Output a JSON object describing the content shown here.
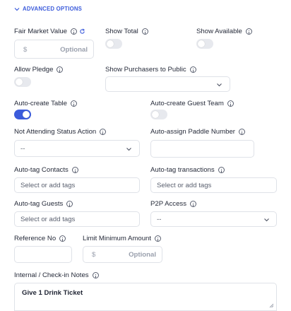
{
  "section": {
    "title": "ADVANCED OPTIONS",
    "color": "#3b5bdb"
  },
  "fields": {
    "fair_market_value": {
      "label": "Fair Market Value",
      "prefix": "$",
      "placeholder": "Optional"
    },
    "show_total": {
      "label": "Show Total",
      "enabled": false
    },
    "show_available": {
      "label": "Show Available",
      "enabled": false
    },
    "allow_pledge": {
      "label": "Allow Pledge",
      "enabled": false
    },
    "show_purchasers": {
      "label": "Show Purchasers to Public",
      "value": ""
    },
    "auto_create_table": {
      "label": "Auto-create Table",
      "enabled": true
    },
    "auto_create_guest_team": {
      "label": "Auto-create Guest Team",
      "enabled": false
    },
    "not_attending_status": {
      "label": "Not Attending Status Action",
      "value": "--"
    },
    "auto_assign_paddle": {
      "label": "Auto-assign Paddle Number",
      "value": ""
    },
    "auto_tag_contacts": {
      "label": "Auto-tag Contacts",
      "placeholder": "Select or add tags"
    },
    "auto_tag_transactions": {
      "label": "Auto-tag transactions",
      "placeholder": "Select or add tags"
    },
    "auto_tag_guests": {
      "label": "Auto-tag Guests",
      "placeholder": "Select or add tags"
    },
    "p2p_access": {
      "label": "P2P Access",
      "value": "--"
    },
    "reference_no": {
      "label": "Reference No",
      "value": ""
    },
    "limit_minimum_amount": {
      "label": "Limit Minimum Amount",
      "prefix": "$",
      "placeholder": "Optional"
    },
    "internal_notes": {
      "label": "Internal / Check-in Notes",
      "value": "Give 1 Drink Ticket"
    }
  }
}
